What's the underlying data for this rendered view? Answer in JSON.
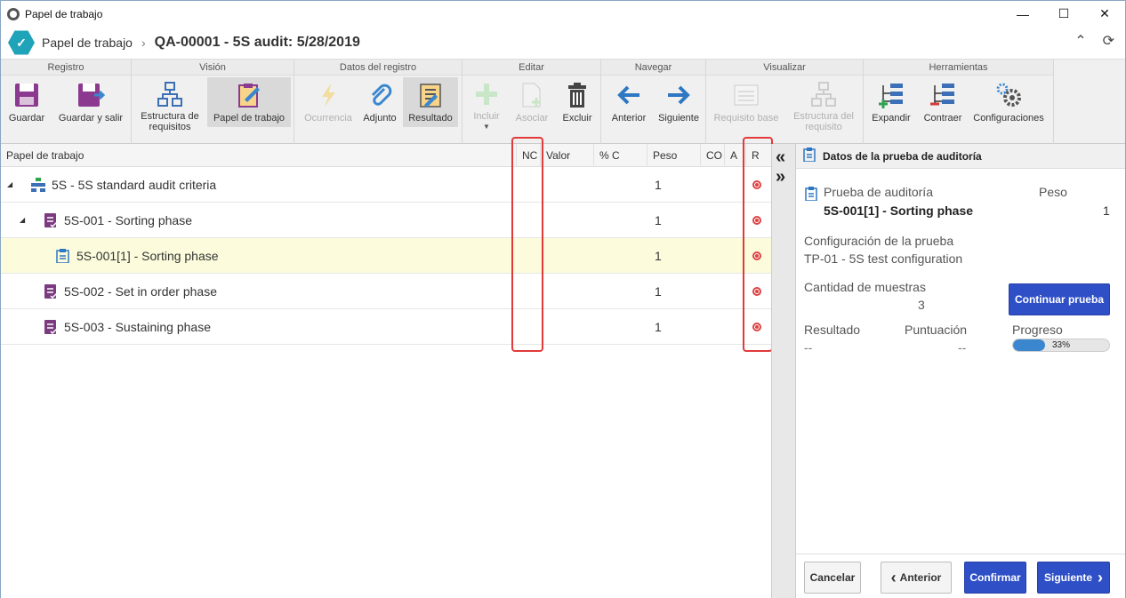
{
  "window": {
    "title": "Papel de trabajo"
  },
  "header": {
    "crumb": "Papel de trabajo",
    "doc_title": "QA-00001 - 5S audit: 5/28/2019"
  },
  "ribbon": {
    "groups": [
      "Registro",
      "Visión",
      "Datos del registro",
      "Editar",
      "Navegar",
      "Visualizar",
      "Herramientas"
    ],
    "tools": {
      "guardar": "Guardar",
      "guardar_salir": "Guardar y salir",
      "estructura_req_1": "Estructura de",
      "estructura_req_2": "requisitos",
      "papel_trabajo": "Papel de trabajo",
      "ocurrencia": "Ocurrencia",
      "adjunto": "Adjunto",
      "resultado": "Resultado",
      "incluir": "Incluir",
      "asociar": "Asociar",
      "excluir": "Excluir",
      "anterior": "Anterior",
      "siguiente": "Siguiente",
      "requisito_base": "Requisito base",
      "estructura_nivel_1": "Estructura del",
      "estructura_nivel_2": "requisito",
      "expandir": "Expandir",
      "contraer": "Contraer",
      "configuraciones": "Configuraciones"
    }
  },
  "grid": {
    "columns": [
      "Papel de trabajo",
      "NC",
      "Valor",
      "% C",
      "Peso",
      "CO",
      "A",
      "R"
    ],
    "rows": [
      {
        "label": "5S - 5S standard audit criteria",
        "peso": "1"
      },
      {
        "label": "5S-001 - Sorting phase",
        "peso": "1"
      },
      {
        "label": "5S-001[1] - Sorting phase",
        "peso": "1"
      },
      {
        "label": "5S-002 - Set in order phase",
        "peso": "1"
      },
      {
        "label": "5S-003 - Sustaining phase",
        "peso": "1"
      }
    ]
  },
  "panel": {
    "title": "Datos de la prueba de auditoría",
    "prueba_label": "Prueba de auditoría",
    "peso_label": "Peso",
    "prueba_value": "5S-001[1] - Sorting phase",
    "peso_value": "1",
    "config_label": "Configuración de la prueba",
    "config_value": "TP-01 - 5S test configuration",
    "muestras_label": "Cantidad de muestras",
    "muestras_value": "3",
    "continuar_label": "Continuar prueba",
    "resultado_label": "Resultado",
    "resultado_value": "--",
    "puntuacion_label": "Puntuación",
    "puntuacion_value": "--",
    "progreso_label": "Progreso",
    "progreso_pct": "33%",
    "progreso_value": 0.33,
    "cancelar": "Cancelar",
    "anterior": "Anterior",
    "confirmar": "Confirmar",
    "siguiente": "Siguiente"
  },
  "colors": {
    "primary": "#2f4fc7",
    "accent": "#1fa3b8",
    "highlight": "#fcfcdc",
    "alert": "#e23a3a"
  }
}
